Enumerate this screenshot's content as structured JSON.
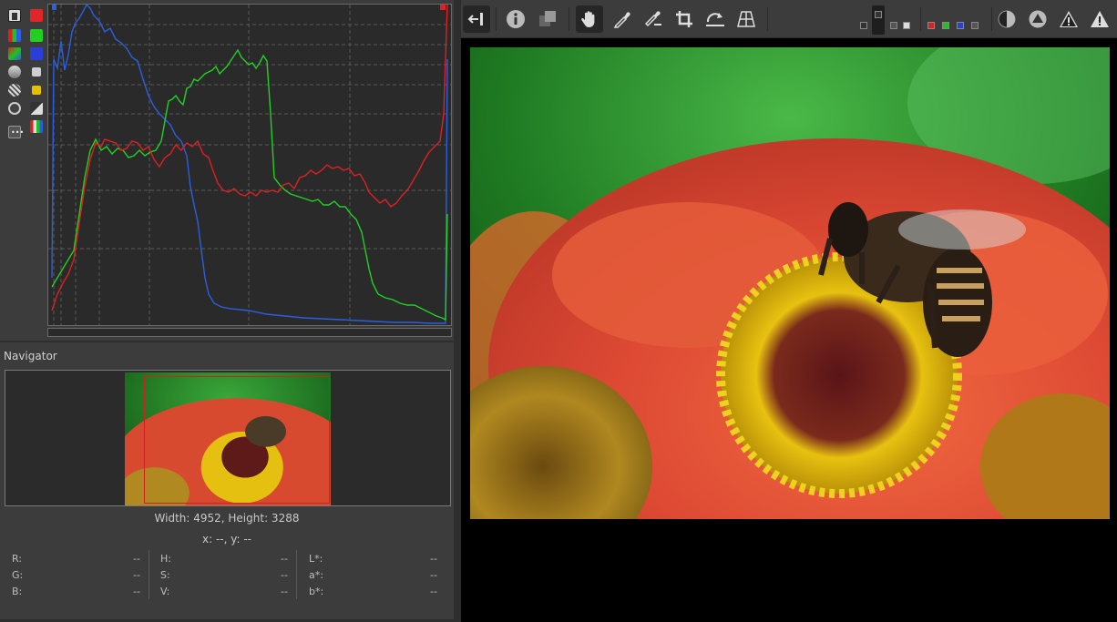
{
  "histogram_tools": {
    "icons": [
      "histogram-linear-icon",
      "channel-red-icon",
      "rgb-bars-icon",
      "channel-green-icon",
      "raw-histogram-icon",
      "channel-blue-icon",
      "chroma-icon",
      "luminance-icon",
      "show-bar-icon",
      "channel-chroma-icon",
      "grid-icon",
      "curve-mode-icon",
      "more-icon",
      "rgb-indicator-bar-icon"
    ]
  },
  "navigator": {
    "title": "Navigator",
    "dimensions": "Width: 4952, Height: 3288",
    "coords": "x: --, y: --"
  },
  "values": {
    "rgb": [
      {
        "label": "R:",
        "value": "--"
      },
      {
        "label": "G:",
        "value": "--"
      },
      {
        "label": "B:",
        "value": "--"
      }
    ],
    "hsv": [
      {
        "label": "H:",
        "value": "--"
      },
      {
        "label": "S:",
        "value": "--"
      },
      {
        "label": "V:",
        "value": "--"
      }
    ],
    "lab": [
      {
        "label": "L*:",
        "value": "--"
      },
      {
        "label": "a*:",
        "value": "--"
      },
      {
        "label": "b*:",
        "value": "--"
      }
    ]
  },
  "toolbar": {
    "buttons": [
      "hide-panel-icon",
      "info-icon",
      "before-after-icon",
      "hand-icon",
      "white-balance-picker-icon",
      "color-picker-icon",
      "crop-icon",
      "straighten-icon",
      "perspective-icon"
    ],
    "right_buttons": [
      "focus-mask-icon",
      "preview-mode-icon",
      "under-exposure-icon",
      "over-exposure-icon"
    ]
  },
  "colors": {
    "red": "#e02020",
    "green": "#20d020",
    "blue": "#2a5fe0",
    "frame": "#d0201c"
  }
}
